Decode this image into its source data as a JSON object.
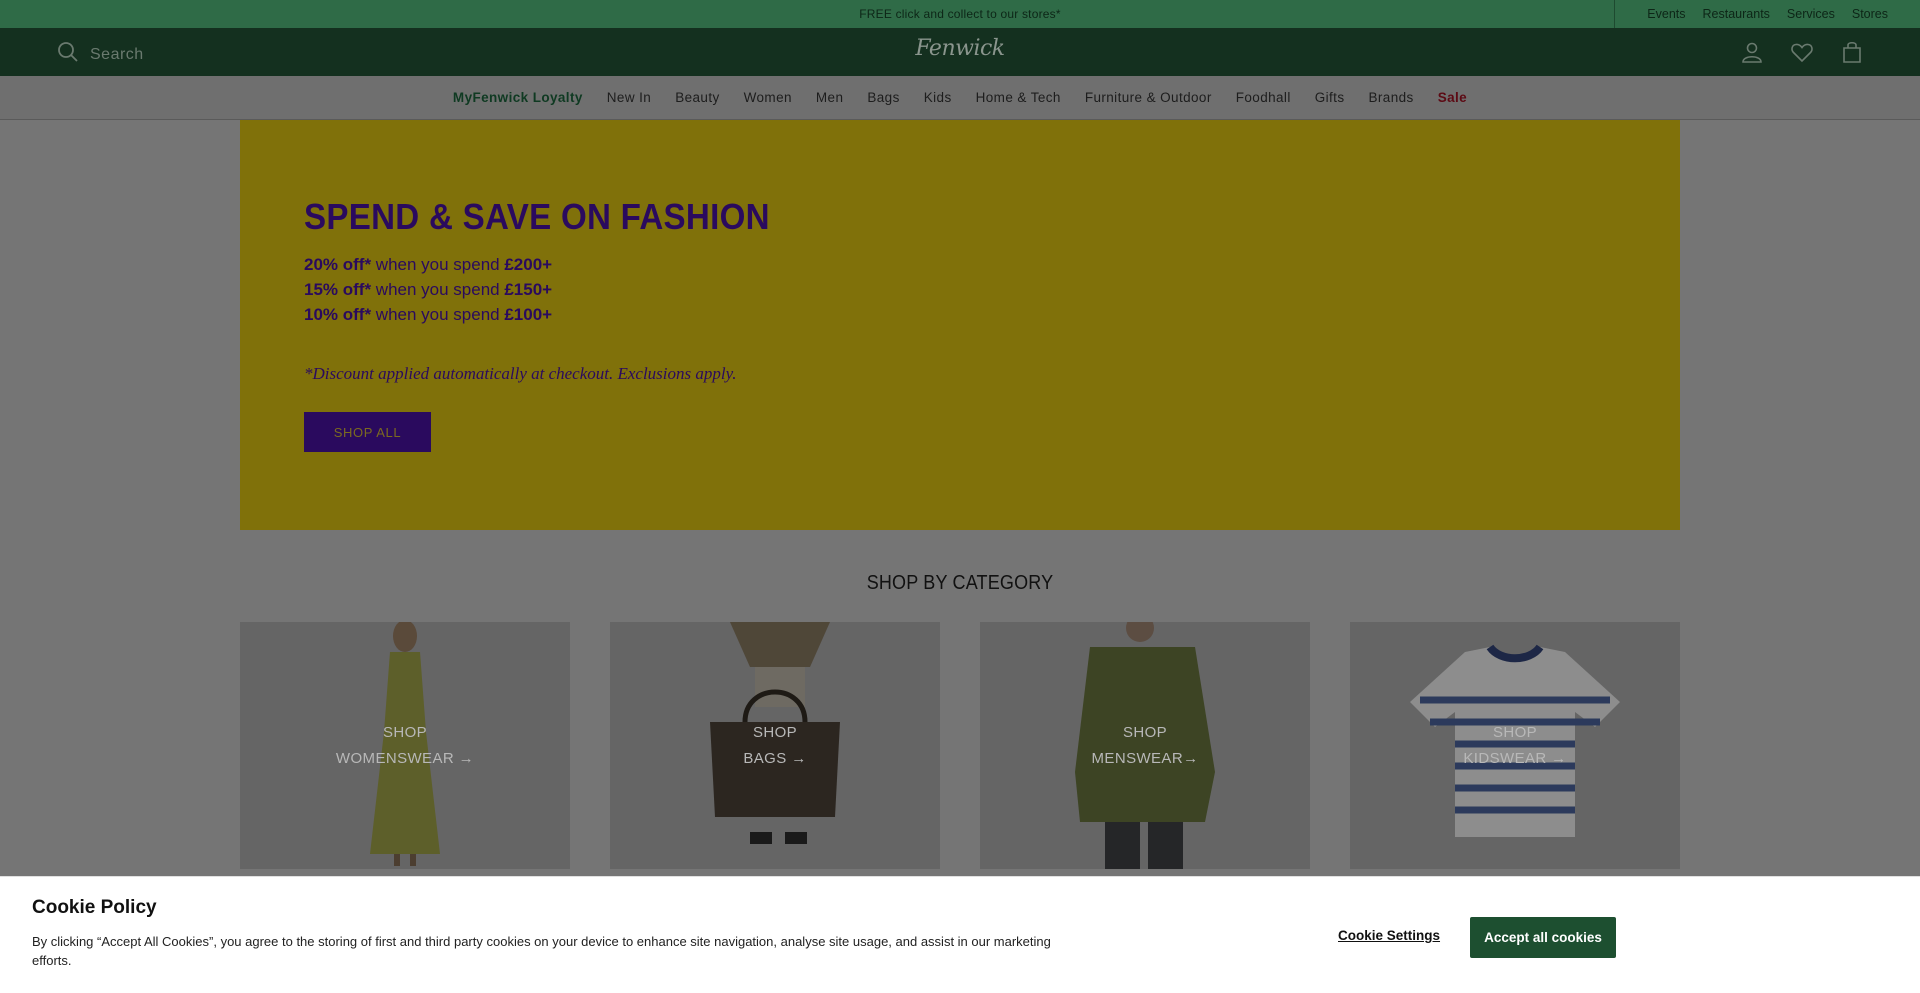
{
  "promo": {
    "text": "FREE click and collect to our stores*",
    "links": [
      "Events",
      "Restaurants",
      "Services",
      "Stores"
    ]
  },
  "header": {
    "search_label": "Search",
    "logo": "Fenwick",
    "icons": [
      "account-icon",
      "wishlist-heart-icon",
      "shopping-bag-icon"
    ]
  },
  "nav": {
    "items": [
      "MyFenwick Loyalty",
      "New In",
      "Beauty",
      "Women",
      "Men",
      "Bags",
      "Kids",
      "Home & Tech",
      "Furniture & Outdoor",
      "Foodhall",
      "Gifts",
      "Brands",
      "Sale"
    ]
  },
  "hero": {
    "title": "SPEND & SAVE ON FASHION",
    "offers": [
      {
        "discount": "20% off*",
        "middle": " when you spend ",
        "threshold": "£200+"
      },
      {
        "discount": "15% off*",
        "middle": " when you spend ",
        "threshold": "£150+"
      },
      {
        "discount": "10% off*",
        "middle": " when you spend ",
        "threshold": "£100+"
      }
    ],
    "disclaimer": "*Discount applied automatically at checkout. Exclusions apply.",
    "button": "SHOP ALL",
    "background_color": "#f2d40f",
    "accent_color": "#4b0f9e"
  },
  "categories": {
    "title": "SHOP BY CATEGORY",
    "cards": [
      {
        "line1": "SHOP",
        "line2": "WOMENSWEAR →"
      },
      {
        "line1": "SHOP",
        "line2": "BAGS →"
      },
      {
        "line1": "SHOP",
        "line2": "MENSWEAR→"
      },
      {
        "line1": "SHOP",
        "line2": "KIDSWEAR →"
      }
    ]
  },
  "cookie": {
    "title": "Cookie Policy",
    "text": "By clicking “Accept All Cookies”, you agree to the storing of first and third party cookies on your device to enhance site navigation, analyse site usage, and assist in our marketing efforts.",
    "settings": "Cookie Settings",
    "accept": "Accept all cookies",
    "accept_color": "#1d4f30"
  }
}
